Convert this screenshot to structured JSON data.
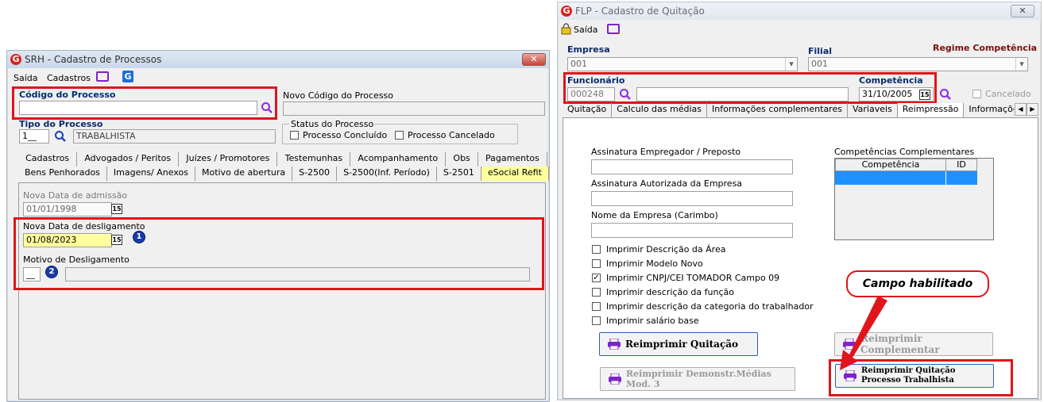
{
  "srh": {
    "title": "SRH - Cadastro de Processos",
    "close": "✕",
    "menu": {
      "saida": "Saída",
      "cadastros": "Cadastros"
    },
    "codigo_label": "Código do Processo",
    "novo_codigo_label": "Novo Código do Processo",
    "tipo_label": "Tipo do Processo",
    "tipo_code": "1__",
    "tipo_desc": "TRABALHISTA",
    "status_label": "Status do Processo",
    "status_concluido": "Processo Concluído",
    "status_cancelado": "Processo Cancelado",
    "tabs_row1": [
      "Cadastros",
      "Advogados / Peritos",
      "Juízes / Promotores",
      "Testemunhas",
      "Acompanhamento",
      "Obs",
      "Pagamentos"
    ],
    "tabs_row2": [
      "Bens Penhorados",
      "Imagens/ Anexos",
      "Motivo de abertura",
      "S-2500",
      "S-2500(Inf. Período)",
      "S-2501",
      "eSocial Refit"
    ],
    "admissao_label": "Nova Data de admissão",
    "admissao_value": "01/01/1998",
    "desligamento_label": "Nova Data de desligamento",
    "desligamento_value": "01/08/2023",
    "motivo_label": "Motivo de Desligamento",
    "motivo_code": "__",
    "badge1": "1",
    "badge2": "2",
    "cal": "15"
  },
  "flp": {
    "title": "FLP - Cadastro de Quitação",
    "close": "✕",
    "saida": "Saída",
    "empresa_label": "Empresa",
    "empresa_value": "001",
    "filial_label": "Filial",
    "filial_value": "001",
    "regime": "Regime Competência",
    "funcionario_label": "Funcionário",
    "funcionario_value": "000248",
    "competencia_label": "Competência",
    "competencia_value": "31/10/2005",
    "cancelado_label": "Cancelado",
    "tabs": [
      "Quitação",
      "Calculo das médias",
      "Informações complementares",
      "Variaveis",
      "Reimpressão",
      "Informações adicionais"
    ],
    "assinatura_empregador": "Assinatura Empregador / Preposto",
    "assinatura_autorizada": "Assinatura Autorizada da Empresa",
    "nome_empresa": "Nome da Empresa (Carimbo)",
    "competencias_label": "Competências Complementares",
    "col_competencia": "Competência",
    "col_id": "ID",
    "checks": [
      {
        "label": "Imprimir Descrição da Área",
        "checked": ""
      },
      {
        "label": "Imprimir Modelo Novo",
        "checked": ""
      },
      {
        "label": "Imprimir CNPJ/CEI TOMADOR Campo 09",
        "checked": "✓"
      },
      {
        "label": "Imprimir descrição da função",
        "checked": ""
      },
      {
        "label": "Imprimir descrição da categoria do trabalhador",
        "checked": ""
      },
      {
        "label": "Imprimir salário base",
        "checked": ""
      }
    ],
    "btn_reimprimir_quitacao": "Reimprimir Quitação",
    "btn_reimprimir_complementar": "Reimprimir Complementar",
    "btn_reimprimir_demonstr": "Reimprimir Demonstr.Médias Mod. 3",
    "btn_reimprimir_processo": "Reimprimir Quitação Processo Trabalhista",
    "callout": "Campo habilitado",
    "cal": "15",
    "arrow_left": "◀",
    "arrow_right": "▶",
    "dropdown": "▾"
  }
}
